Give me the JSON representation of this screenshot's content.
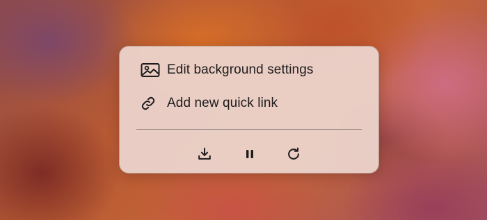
{
  "menu": {
    "items": [
      {
        "icon": "image-icon",
        "label": "Edit background settings"
      },
      {
        "icon": "link-icon",
        "label": "Add new quick link"
      }
    ],
    "toolbar": [
      {
        "icon": "download-icon",
        "action": "download"
      },
      {
        "icon": "pause-icon",
        "action": "pause"
      },
      {
        "icon": "refresh-icon",
        "action": "refresh"
      }
    ]
  },
  "colors": {
    "menu_background": "#ecd5cd",
    "text": "#1d1b1c",
    "divider": "#a4938f"
  }
}
